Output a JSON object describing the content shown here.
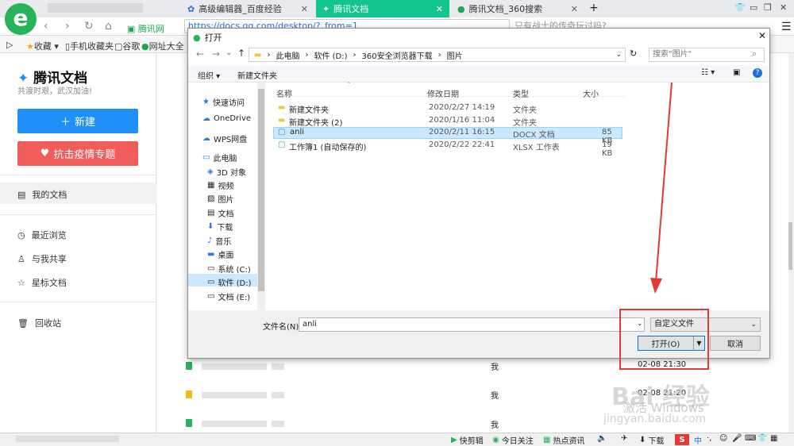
{
  "browser": {
    "tabs": [
      {
        "label": "高级编辑器_百度经验"
      },
      {
        "label": "腾讯文档"
      },
      {
        "label": "腾讯文档_360搜索"
      }
    ],
    "new_tab": "+",
    "site_label": "腾讯网",
    "address": "https://docs.qq.com/desktop/?_from=1",
    "search_text": "只有战士的传奇玩过吗?",
    "bookmarks": [
      "收藏",
      "手机收藏夹",
      "谷歌",
      "网址大全"
    ]
  },
  "app": {
    "brand": "腾讯文档",
    "brand_sub": "共渡时艰，武汉加油!",
    "new_button": "新建",
    "epidemic_button": "抗击疫情专题",
    "nav": [
      {
        "label": "我的文档"
      },
      {
        "label": "最近浏览"
      },
      {
        "label": "与我共享"
      },
      {
        "label": "星标文档"
      },
      {
        "label": "回收站"
      }
    ],
    "list_rows": [
      {
        "owner": "我",
        "time": "02-08 21:30"
      },
      {
        "owner": "我",
        "time": "02-08 21:20"
      },
      {
        "owner": "我",
        "time": ""
      }
    ]
  },
  "dialog": {
    "title": "打开",
    "breadcrumb": [
      "此电脑",
      "软件 (D:)",
      "360安全浏览器下载",
      "图片"
    ],
    "search_placeholder": "搜索\"图片\"",
    "organize": "组织",
    "new_folder": "新建文件夹",
    "tree": [
      {
        "label": "快速访问",
        "icon": "star-icon"
      },
      {
        "label": "OneDrive",
        "icon": "cloud-icon"
      },
      {
        "label": "WPS网盘",
        "icon": "cloud-icon"
      },
      {
        "label": "此电脑",
        "icon": "computer-icon"
      },
      {
        "label": "3D 对象",
        "icon": "cube-icon"
      },
      {
        "label": "视频",
        "icon": "video-icon"
      },
      {
        "label": "图片",
        "icon": "picture-icon"
      },
      {
        "label": "文档",
        "icon": "document-icon"
      },
      {
        "label": "下载",
        "icon": "download-icon"
      },
      {
        "label": "音乐",
        "icon": "music-icon"
      },
      {
        "label": "桌面",
        "icon": "desktop-icon"
      },
      {
        "label": "系统 (C:)",
        "icon": "drive-icon"
      },
      {
        "label": "软件 (D:)",
        "icon": "drive-icon"
      },
      {
        "label": "文档 (E:)",
        "icon": "drive-icon"
      }
    ],
    "columns": {
      "name": "名称",
      "date": "修改日期",
      "type": "类型",
      "size": "大小"
    },
    "files": [
      {
        "name": "新建文件夹",
        "date": "2020/2/27 14:19",
        "type": "文件夹",
        "size": "",
        "icon": "folder-icon"
      },
      {
        "name": "新建文件夹 (2)",
        "date": "2020/1/16 11:04",
        "type": "文件夹",
        "size": "",
        "icon": "folder-icon"
      },
      {
        "name": "anli",
        "date": "2020/2/11 16:15",
        "type": "DOCX 文档",
        "size": "85 KB",
        "icon": "docx-icon"
      },
      {
        "name": "工作簿1 (自动保存的)",
        "date": "2020/2/22 22:41",
        "type": "XLSX 工作表",
        "size": "19 KB",
        "icon": "xlsx-icon"
      }
    ],
    "filename_label": "文件名(N):",
    "filename_value": "anli",
    "filetype": "自定义文件",
    "open_button": "打开(O)",
    "cancel_button": "取消"
  },
  "statusbar": {
    "items": [
      "快剪辑",
      "今日关注",
      "热点资讯",
      "下载"
    ]
  },
  "watermark": {
    "line1": "Bai 经验",
    "line2": "激活 Windows",
    "line3": "jingyan.baidu.com"
  },
  "colors": {
    "accent_green": "#12c48e",
    "new_blue": "#1e90f8",
    "epidemic_red": "#f05d5b",
    "highlight_red": "#e53935",
    "select_blue": "#cce8ff"
  }
}
